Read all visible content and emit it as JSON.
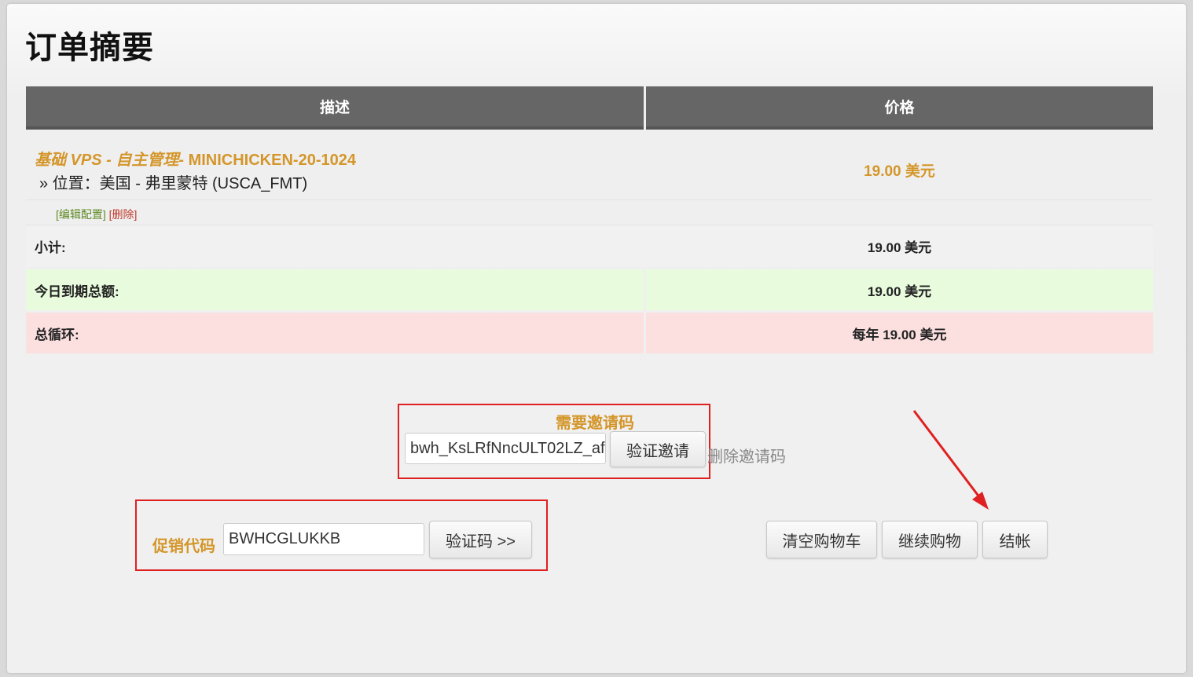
{
  "page": {
    "title": "订单摘要"
  },
  "table": {
    "headers": {
      "description": "描述",
      "price": "价格"
    },
    "product": {
      "name_italic": "基础 VPS - 自主管理",
      "name_rest": "- MINICHICKEN-20-1024",
      "location": "» 位置：美国 - 弗里蒙特 (USCA_FMT)",
      "price": "19.00 美元",
      "edit_link": "[编辑配置]",
      "delete_link": "[删除]"
    },
    "subtotal": {
      "label": "小计:",
      "value": "19.00 美元"
    },
    "due_today": {
      "label": "今日到期总额:",
      "value": "19.00 美元"
    },
    "recurring": {
      "label": "总循环:",
      "value": "每年 19.00 美元"
    }
  },
  "invite": {
    "heading": "需要邀请码",
    "value": "bwh_KsLRfNncULT02LZ_af",
    "verify_button": "验证邀请",
    "remove_link": "删除邀请码"
  },
  "promo": {
    "label": "促销代码",
    "value": "BWHCGLUKKB",
    "verify_button": "验证码 >>"
  },
  "actions": {
    "empty_cart": "清空购物车",
    "continue_shopping": "继续购物",
    "checkout": "结帐"
  },
  "colors": {
    "accent": "#d4962a",
    "header_bg": "#666666",
    "due_today_bg": "#e8fbdc",
    "recurring_bg": "#fce0e0",
    "annotation_red": "#e02020"
  }
}
